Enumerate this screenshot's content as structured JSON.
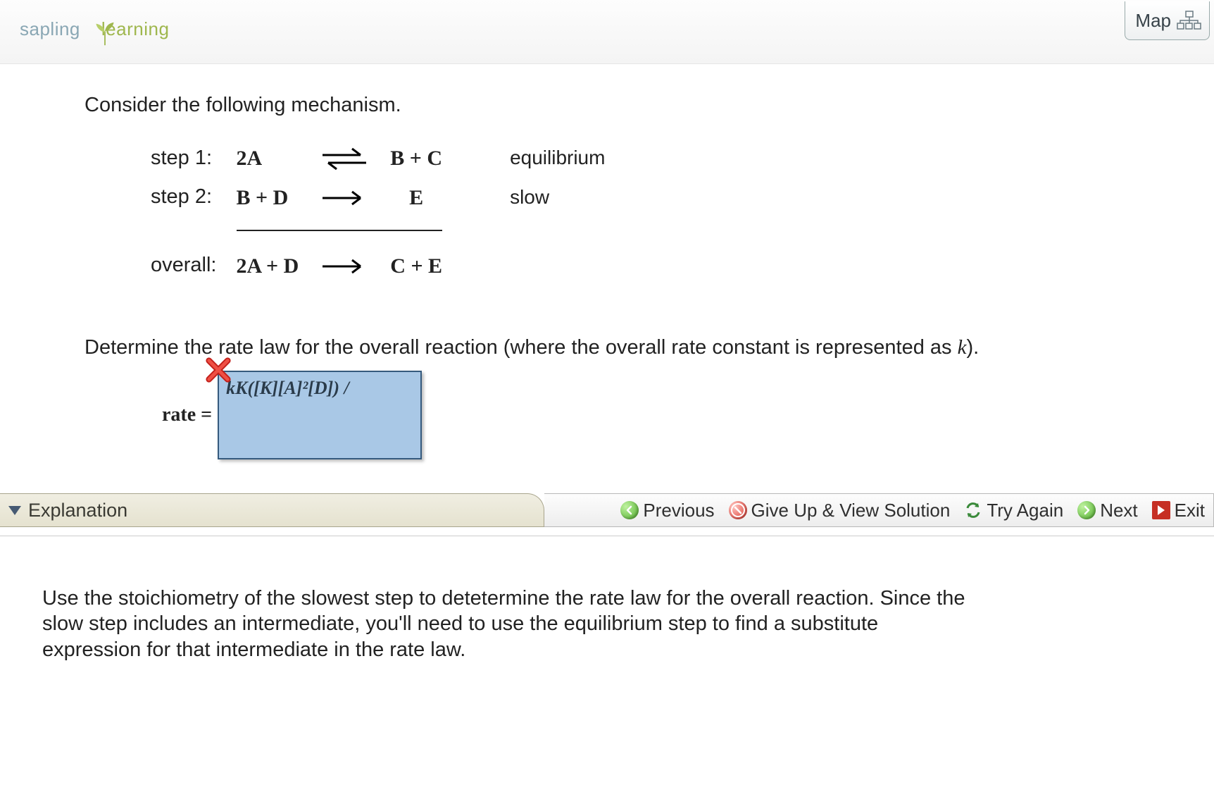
{
  "header": {
    "logo_a": "sapling",
    "logo_b": "learning",
    "map_label": "Map"
  },
  "problem": {
    "intro": "Consider the following mechanism.",
    "steps": {
      "s1_label": "step 1:",
      "s1_lhs": "2A",
      "s1_rhs": "B + C",
      "s1_note": "equilibrium",
      "s2_label": "step 2:",
      "s2_lhs": "B + D",
      "s2_rhs": "E",
      "s2_note": "slow",
      "ov_label": "overall:",
      "ov_lhs": "2A + D",
      "ov_rhs": "C + E"
    },
    "question_a": "Determine the rate law for the overall reaction (where the overall rate constant is represented as ",
    "question_b": ").",
    "k_symbol": "k",
    "rate_label": "rate =",
    "answer_entered": "kK([K][A]²[D]) /"
  },
  "footer": {
    "explanation": "Explanation",
    "previous": "Previous",
    "give_up": "Give Up & View Solution",
    "try_again": "Try Again",
    "next": "Next",
    "exit": "Exit"
  },
  "explanation_text": "Use the stoichiometry of the slowest step to detetermine the rate law for the overall reaction. Since the slow step includes an intermediate, you'll need to use the equilibrium step to find a substitute expression for that intermediate in the rate law."
}
